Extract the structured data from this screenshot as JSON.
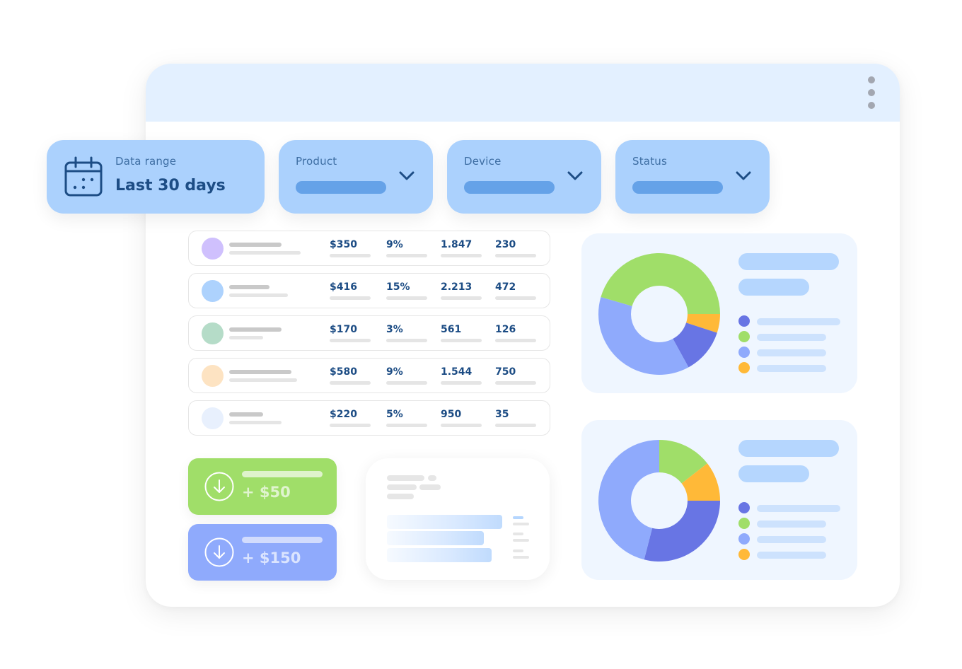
{
  "window": {
    "menu_icon": "more-vertical-icon"
  },
  "filters": {
    "date_range": {
      "label": "Data range",
      "value": "Last 30 days",
      "icon": "calendar-icon"
    },
    "product": {
      "label": "Product",
      "icon": "chevron-down-icon"
    },
    "device": {
      "label": "Device",
      "icon": "chevron-down-icon"
    },
    "status": {
      "label": "Status",
      "icon": "chevron-down-icon"
    }
  },
  "table": {
    "rows": [
      {
        "avatar_color": "#cfc0fd",
        "revenue": "$350",
        "percent": "9%",
        "views": "1.847",
        "count": "230"
      },
      {
        "avatar_color": "#add2fd",
        "revenue": "$416",
        "percent": "15%",
        "views": "2.213",
        "count": "472"
      },
      {
        "avatar_color": "#b5dcc8",
        "revenue": "$170",
        "percent": "3%",
        "views": "561",
        "count": "126"
      },
      {
        "avatar_color": "#fde3c2",
        "revenue": "$580",
        "percent": "9%",
        "views": "1.544",
        "count": "750"
      },
      {
        "avatar_color": "#e8f0fd",
        "revenue": "$220",
        "percent": "5%",
        "views": "950",
        "count": "35"
      }
    ]
  },
  "payments": [
    {
      "amount": "+ $50",
      "icon": "arrow-down-circle-icon",
      "color": "#a0de69"
    },
    {
      "amount": "+ $150",
      "icon": "arrow-down-circle-icon",
      "color": "#8faafc"
    }
  ],
  "colors": {
    "dark_blue": "#6875e4",
    "green": "#a0de69",
    "light_blue": "#8faafc",
    "orange": "#ffb938",
    "filter_bg": "#abd1fd",
    "text_dark": "#1c4c84"
  },
  "chart_data": [
    {
      "type": "pie",
      "title": "",
      "donut": true,
      "start": "3-o'clock, clockwise",
      "categories": [
        "orange",
        "dark_blue",
        "light_blue",
        "green"
      ],
      "values": [
        5,
        12,
        37.5,
        45.5
      ]
    },
    {
      "type": "pie",
      "title": "",
      "donut": true,
      "start": "12-o'clock, clockwise",
      "categories": [
        "green",
        "orange",
        "dark_blue",
        "light_blue"
      ],
      "values": [
        14.5,
        10.5,
        29,
        46
      ]
    }
  ]
}
